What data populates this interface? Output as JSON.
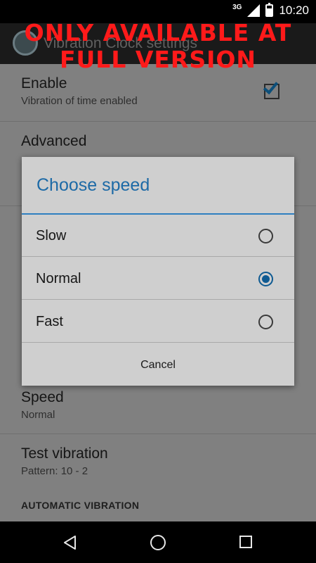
{
  "status_bar": {
    "network": "3G",
    "time": "10:20"
  },
  "action_bar": {
    "title": "Vibration Clock settings"
  },
  "banner": {
    "line1": "ONLY AVAILABLE AT",
    "line2": "FULL VERSION"
  },
  "settings": {
    "enable": {
      "title": "Enable",
      "summary": "Vibration of time enabled",
      "checked": true
    },
    "advanced": {
      "title": "Advanced"
    },
    "speed": {
      "title": "Speed",
      "summary": "Normal"
    },
    "test_vibration": {
      "title": "Test vibration",
      "summary": "Pattern: 10 - 2"
    },
    "category_automatic": "AUTOMATIC VIBRATION"
  },
  "dialog": {
    "title": "Choose speed",
    "options": [
      {
        "label": "Slow",
        "selected": false
      },
      {
        "label": "Normal",
        "selected": true
      },
      {
        "label": "Fast",
        "selected": false
      }
    ],
    "cancel_label": "Cancel"
  },
  "colors": {
    "accent": "#1d6aa6",
    "banner": "#ff1a1a"
  }
}
